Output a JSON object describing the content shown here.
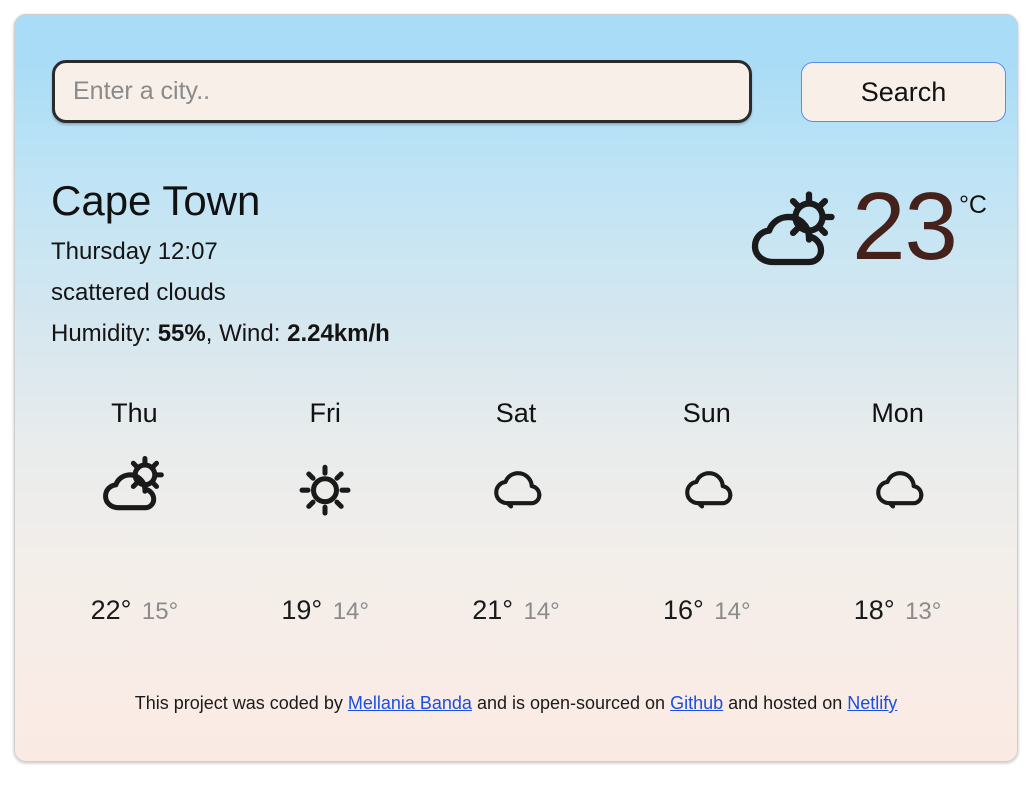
{
  "search": {
    "placeholder": "Enter a city..",
    "value": "",
    "button_label": "Search"
  },
  "current": {
    "city": "Cape Town",
    "datetime": "Thursday 12:07",
    "description": "scattered clouds",
    "humidity_label": "Humidity: ",
    "humidity_value": "55%",
    "wind_label": ", Wind: ",
    "wind_value": "2.24km/h",
    "temperature": "23",
    "unit": "°C",
    "icon": "sun-behind-cloud-icon",
    "temp_color": "#45211c"
  },
  "forecast": {
    "days": [
      {
        "label": "Thu",
        "icon": "sun-behind-cloud-icon",
        "max": "22°",
        "min": "15°"
      },
      {
        "label": "Fri",
        "icon": "sun-icon",
        "max": "19°",
        "min": "14°"
      },
      {
        "label": "Sat",
        "icon": "cloud-icon",
        "max": "21°",
        "min": "14°"
      },
      {
        "label": "Sun",
        "icon": "cloud-icon",
        "max": "16°",
        "min": "14°"
      },
      {
        "label": "Mon",
        "icon": "cloud-icon",
        "max": "18°",
        "min": "13°"
      }
    ]
  },
  "footer": {
    "text_1": "This project was coded by ",
    "link_author": "Mellania Banda",
    "text_2": " and is open-sourced on ",
    "link_source": "Github",
    "text_3": " and hosted on ",
    "link_host": "Netlify"
  },
  "theme": {
    "card_top_color": "#a9dcf6",
    "card_bottom_color": "#fbeae3",
    "link_color": "#1a4fe0",
    "input_bg": "#f8efe9"
  }
}
